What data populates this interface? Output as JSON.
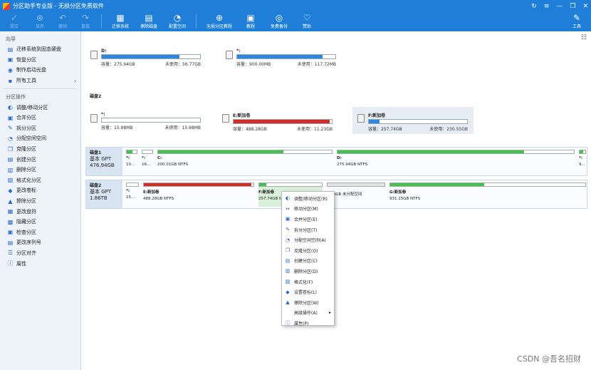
{
  "window": {
    "title": "分区助手专业版 - 无损分区免费软件",
    "controls": [
      "↻",
      "≡",
      "—",
      "❐",
      "✕"
    ]
  },
  "toolbar": {
    "buttons": [
      {
        "label": "提交",
        "icon": "check-icon",
        "glyph": "✓",
        "disabled": true
      },
      {
        "label": "放弃",
        "icon": "discard-icon",
        "glyph": "⊗",
        "disabled": true
      },
      {
        "label": "撤销",
        "icon": "undo-icon",
        "glyph": "↶",
        "disabled": true
      },
      {
        "label": "重做",
        "icon": "redo-icon",
        "glyph": "↷",
        "disabled": true
      },
      {
        "label": "迁移系统",
        "icon": "migrate-os-icon",
        "glyph": "▦",
        "disabled": false
      },
      {
        "label": "擦除磁盘",
        "icon": "wipe-disk-icon",
        "glyph": "▤",
        "disabled": false
      },
      {
        "label": "配置空间",
        "icon": "allocate-space-icon",
        "glyph": "◔",
        "disabled": false
      },
      {
        "label": "无损分区教程",
        "icon": "tutorial-icon",
        "glyph": "⊕",
        "disabled": false
      },
      {
        "label": "教程",
        "icon": "book-icon",
        "glyph": "▣",
        "disabled": false
      },
      {
        "label": "免费备份",
        "icon": "backup-icon",
        "glyph": "◎",
        "disabled": false
      },
      {
        "label": "赞助",
        "icon": "heart-icon",
        "glyph": "♡",
        "disabled": false
      }
    ],
    "tools_label": "工具"
  },
  "sidebar": {
    "wizard_title": "向导",
    "wizard_items": [
      {
        "label": "迁移系统到固态硬盘",
        "icon": "migrate-icon",
        "glyph": "▤"
      },
      {
        "label": "恢复分区",
        "icon": "recover-icon",
        "glyph": "▣"
      },
      {
        "label": "制作启动光盘",
        "icon": "boot-disc-icon",
        "glyph": "◉"
      },
      {
        "label": "所有工具",
        "icon": "all-tools-icon",
        "glyph": "▪"
      }
    ],
    "ops_title": "分区操作",
    "ops_items": [
      {
        "label": "调整/移动分区",
        "icon": "resize-icon",
        "glyph": "◐"
      },
      {
        "label": "合并分区",
        "icon": "merge-icon",
        "glyph": "▣"
      },
      {
        "label": "拆分分区",
        "icon": "split-icon",
        "glyph": "✎"
      },
      {
        "label": "分配空闲空间",
        "icon": "allocate-icon",
        "glyph": "◔"
      },
      {
        "label": "克隆分区",
        "icon": "clone-icon",
        "glyph": "❐"
      },
      {
        "label": "创建分区",
        "icon": "create-icon",
        "glyph": "▤"
      },
      {
        "label": "删除分区",
        "icon": "delete-icon",
        "glyph": "▥"
      },
      {
        "label": "格式化分区",
        "icon": "format-icon",
        "glyph": "▧"
      },
      {
        "label": "更改卷标",
        "icon": "label-icon",
        "glyph": "◆"
      },
      {
        "label": "擦除分区",
        "icon": "wipe-icon",
        "glyph": "▲"
      },
      {
        "label": "更改盘符",
        "icon": "drive-letter-icon",
        "glyph": "▦"
      },
      {
        "label": "隐藏分区",
        "icon": "hide-icon",
        "glyph": "▩"
      },
      {
        "label": "检查分区",
        "icon": "check-partition-icon",
        "glyph": "▣"
      },
      {
        "label": "更改序列号",
        "icon": "serial-icon",
        "glyph": "▤"
      },
      {
        "label": "分区对齐",
        "icon": "align-icon",
        "glyph": "☰"
      },
      {
        "label": "属性",
        "icon": "info-icon",
        "glyph": "ⓘ"
      }
    ]
  },
  "disk1_volumes": [
    {
      "name": "D:",
      "capacity": "容量：275.94GB",
      "free": "未使用：56.77GB",
      "used_pct": 79,
      "color": "#2f86e0"
    },
    {
      "name": "*:",
      "capacity": "容量：900.00MB",
      "free": "未使用：117.72MB",
      "used_pct": 87,
      "color": "#2f86e0"
    }
  ],
  "disk2_label": "磁盘2",
  "disk2_volumes": [
    {
      "name": "*:",
      "capacity": "容量：15.98MB",
      "free": "未使用：15.98MB",
      "used_pct": 0,
      "color": "#2f86e0"
    },
    {
      "name": "E:新加卷",
      "capacity": "容量：488.28GB",
      "free": "未使用：11.23GB",
      "used_pct": 98,
      "color": "#d62b2b"
    },
    {
      "name": "F:新加卷",
      "capacity": "容量：257.74GB",
      "free": "未使用：230.55GB",
      "used_pct": 11,
      "color": "#2f86e0"
    }
  ],
  "diskmap": {
    "disk1": {
      "name": "磁盘1",
      "type": "基本 GPT",
      "size": "476.94GB",
      "parts": [
        {
          "name": "*:",
          "size": "10...",
          "fill": 60,
          "color": "#3ec44a"
        },
        {
          "name": "*:",
          "size": "16...",
          "fill": 0,
          "color": "#3ec44a"
        },
        {
          "name": "C:",
          "size": "200.01GB NTFS",
          "fill": 72,
          "color": "#3ec44a"
        },
        {
          "name": "D:",
          "size": "275.94GB NTFS",
          "fill": 79,
          "color": "#3ec44a"
        },
        {
          "name": "*:",
          "size": "9...",
          "fill": 60,
          "color": "#3ec44a"
        }
      ]
    },
    "disk2": {
      "name": "磁盘2",
      "type": "基本 GPT",
      "size": "1.86TB",
      "parts": [
        {
          "name": "*:",
          "size": "15...",
          "fill": 0,
          "color": "#3ec44a"
        },
        {
          "name": "E:新加卷",
          "size": "488.28GB NTFS",
          "fill": 98,
          "color": "#d62b2b"
        },
        {
          "name": "F:新加卷",
          "size": "257.74GB NTFS",
          "fill": 11,
          "color": "#3ec44a"
        },
        {
          "name": "",
          "size": "...54GB 未分配空间",
          "fill": 0,
          "color": "#3ec44a"
        },
        {
          "name": "G:新加卷",
          "size": "931.15GB NTFS",
          "fill": 48,
          "color": "#3ec44a"
        }
      ]
    }
  },
  "context_menu": [
    {
      "label": "调整/移动分区(R)",
      "icon": "resize-icon",
      "glyph": "◐"
    },
    {
      "label": "移动分区(M)",
      "icon": "move-icon",
      "glyph": "↔"
    },
    {
      "label": "合并分区(E)",
      "icon": "merge-icon",
      "glyph": "▣"
    },
    {
      "label": "拆分分区(T)",
      "icon": "split-icon",
      "glyph": "✎"
    },
    {
      "label": "分配空闲空间(A)",
      "icon": "allocate-icon",
      "glyph": "◔"
    },
    {
      "label": "克隆分区(O)",
      "icon": "clone-icon",
      "glyph": "❐"
    },
    {
      "label": "创建分区(C)",
      "icon": "create-icon",
      "glyph": "▤"
    },
    {
      "label": "删除分区(D)",
      "icon": "delete-icon",
      "glyph": "▥"
    },
    {
      "label": "格式化(F)",
      "icon": "format-icon",
      "glyph": "▧"
    },
    {
      "label": "设置卷标(L)",
      "icon": "label-icon",
      "glyph": "◆"
    },
    {
      "label": "擦除分区(W)",
      "icon": "wipe-icon",
      "glyph": "▲"
    },
    {
      "label": "高级操作(A)",
      "icon": "",
      "glyph": "",
      "submenu": true
    },
    {
      "label": "属性(P)",
      "icon": "info-icon",
      "glyph": "ⓘ"
    }
  ],
  "watermark": "CSDN @吾名招财"
}
